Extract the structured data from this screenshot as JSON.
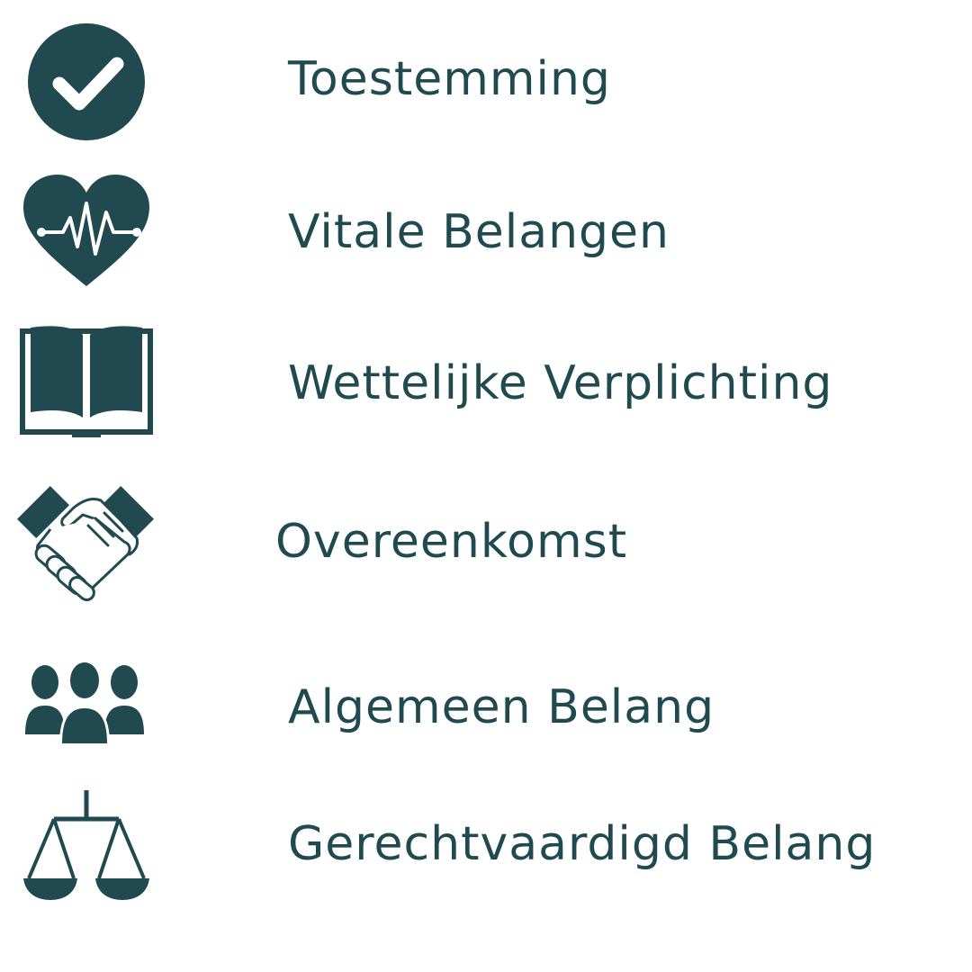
{
  "theme": {
    "ink": "#214a50",
    "background": "#ffffff"
  },
  "items": [
    {
      "label": "Toestemming",
      "icon": "check-circle-icon"
    },
    {
      "label": "Vitale Belangen",
      "icon": "heart-pulse-icon"
    },
    {
      "label": "Wettelijke Verplichting",
      "icon": "open-book-icon"
    },
    {
      "label": "Overeenkomst",
      "icon": "handshake-icon"
    },
    {
      "label": "Algemeen Belang",
      "icon": "people-group-icon"
    },
    {
      "label": "Gerechtvaardigd Belang",
      "icon": "balance-scale-icon"
    }
  ]
}
